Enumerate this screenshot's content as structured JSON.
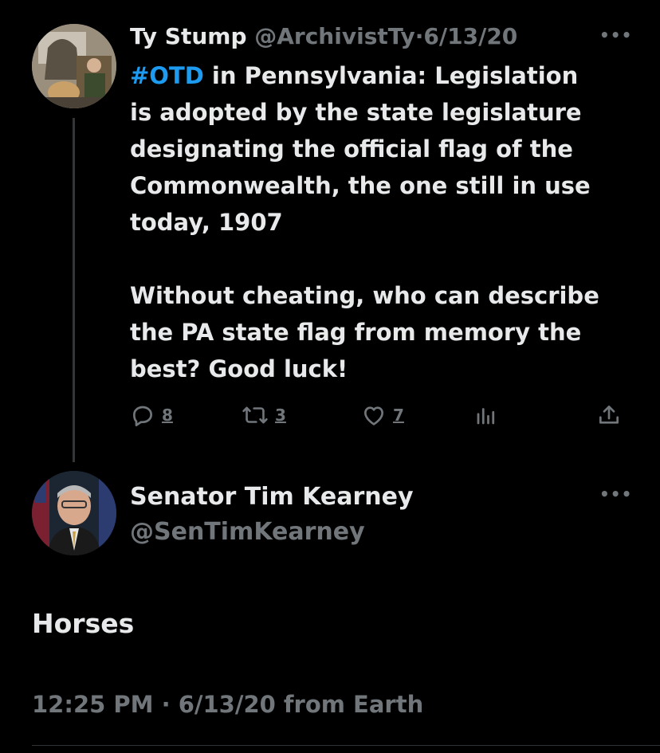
{
  "thread": {
    "parent": {
      "display_name": "Ty Stump",
      "handle": "@ArchivistTy",
      "separator": "·",
      "date": "6/13/20",
      "more_icon": "more-horizontal-icon",
      "hashtag": "#OTD",
      "text_after_hashtag": " in Pennsylvania: Legislation\nis adopted by the state legislature\ndesignating the official flag of the\nCommonwealth, the one still in use\ntoday, 1907\n\nWithout cheating, who can describe\nthe PA state flag from memory the\nbest? Good luck!",
      "actions": {
        "reply_count": "8",
        "retweet_count": "3",
        "like_count": "7"
      }
    },
    "reply": {
      "display_name": "Senator Tim Kearney",
      "handle": "@SenTimKearney",
      "text": "Horses",
      "timestamp": "12:25 PM · 6/13/20 from Earth"
    }
  },
  "colors": {
    "background": "#000000",
    "text": "#e7e9ea",
    "muted": "#71767b",
    "link": "#1d9bf0"
  }
}
